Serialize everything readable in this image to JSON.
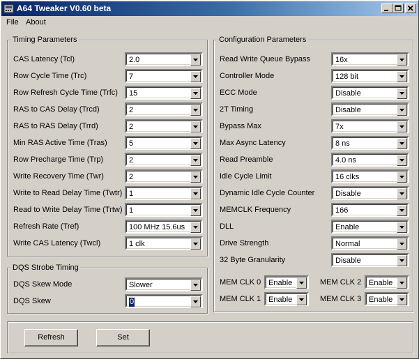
{
  "window": {
    "title": "A64 Tweaker V0.60 beta"
  },
  "menu": {
    "file": "File",
    "about": "About"
  },
  "timing": {
    "title": "Timing Parameters",
    "rows": [
      {
        "label": "CAS Latency (Tcl)",
        "value": "2.0"
      },
      {
        "label": "Row Cycle Time (Trc)",
        "value": "7"
      },
      {
        "label": "Row Refresh Cycle Time (Trfc)",
        "value": "15"
      },
      {
        "label": "RAS to CAS Delay (Trcd)",
        "value": "2"
      },
      {
        "label": "RAS to RAS Delay (Trrd)",
        "value": "2"
      },
      {
        "label": "Min RAS Active Time (Tras)",
        "value": "5"
      },
      {
        "label": "Row Precharge Time (Trp)",
        "value": "2"
      },
      {
        "label": "Write Recovery Time (Twr)",
        "value": "2"
      },
      {
        "label": "Write to Read Delay Time (Twtr)",
        "value": "1"
      },
      {
        "label": "Read to Write Delay Time (Trtw)",
        "value": "1"
      },
      {
        "label": "Refresh Rate (Tref)",
        "value": "100 MHz 15.6us"
      },
      {
        "label": "Write CAS Latency (Twcl)",
        "value": "1 clk"
      }
    ]
  },
  "dqs": {
    "title": "DQS Strobe Timing",
    "rows": [
      {
        "label": "DQS Skew Mode",
        "value": "Slower"
      },
      {
        "label": "DQS Skew",
        "value": "0"
      }
    ]
  },
  "config": {
    "title": "Configuration Parameters",
    "rows": [
      {
        "label": "Read Write Queue Bypass",
        "value": "16x"
      },
      {
        "label": "Controller Mode",
        "value": "128 bit"
      },
      {
        "label": "ECC Mode",
        "value": "Disable"
      },
      {
        "label": "2T Timing",
        "value": "Disable"
      },
      {
        "label": "Bypass Max",
        "value": "7x"
      },
      {
        "label": "Max Async Latency",
        "value": "8 ns"
      },
      {
        "label": "Read Preamble",
        "value": "4.0 ns"
      },
      {
        "label": "Idle Cycle Limit",
        "value": "16 clks"
      },
      {
        "label": "Dynamic Idle Cycle Counter",
        "value": "Disable"
      },
      {
        "label": "MEMCLK Frequency",
        "value": "166"
      },
      {
        "label": "DLL",
        "value": "Enable"
      },
      {
        "label": "Drive Strength",
        "value": "Normal"
      },
      {
        "label": "32 Byte Granularity",
        "value": "Disable"
      }
    ],
    "memclk": [
      {
        "label": "MEM CLK 0",
        "value": "Enable"
      },
      {
        "label": "MEM CLK 2",
        "value": "Enable"
      },
      {
        "label": "MEM CLK 1",
        "value": "Enable"
      },
      {
        "label": "MEM CLK 3",
        "value": "Enable"
      }
    ]
  },
  "buttons": {
    "refresh": "Refresh",
    "set": "Set"
  }
}
